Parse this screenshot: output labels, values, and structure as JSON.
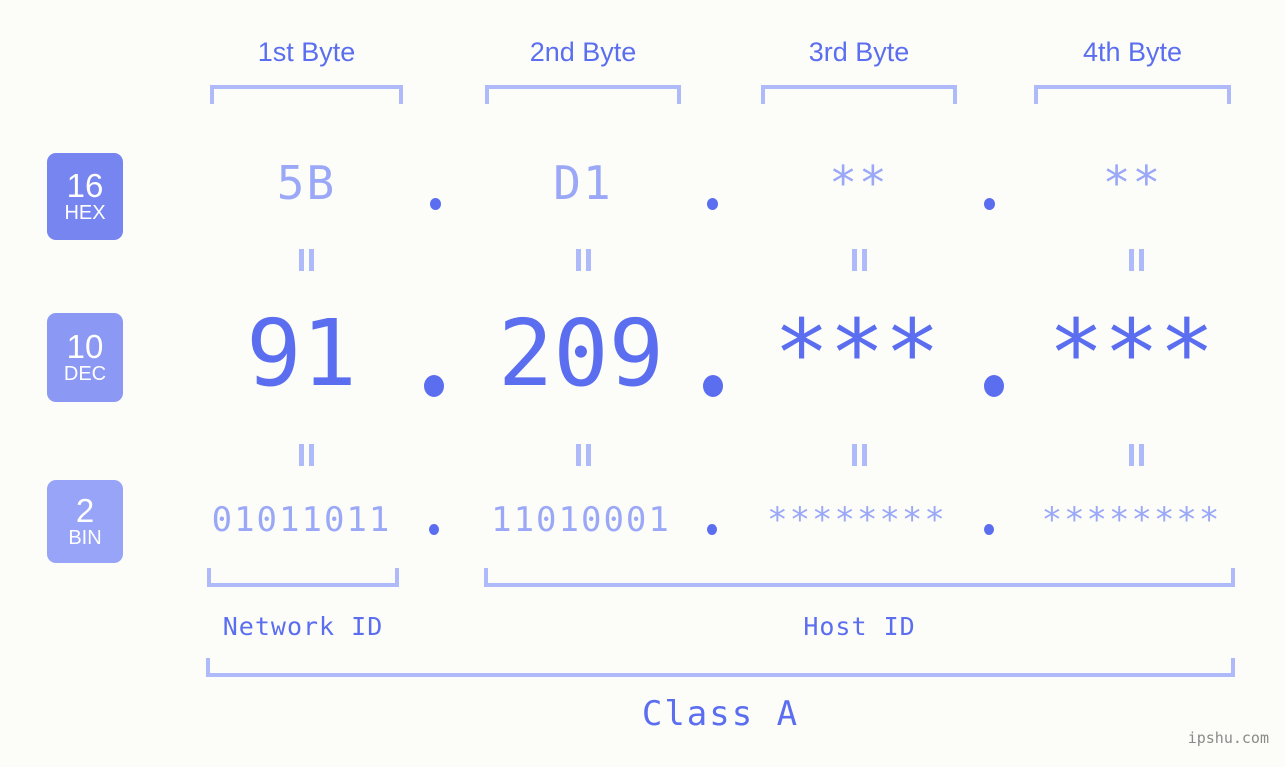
{
  "theme": {
    "background": "#fcfdf8",
    "accent_dark": "#5b6ef0",
    "accent_light": "#afbafa",
    "value_light": "#9aa8f7",
    "badge_hex": "#7685ef",
    "badge_dec": "#8b98f4",
    "badge_bin": "#97a4f7",
    "watermark_color": "#8a8a8a"
  },
  "header": {
    "bytes": [
      {
        "label": "1st Byte"
      },
      {
        "label": "2nd Byte"
      },
      {
        "label": "3rd Byte"
      },
      {
        "label": "4th Byte"
      }
    ]
  },
  "rows": [
    {
      "key": "hex",
      "badge_number": "16",
      "badge_abbr": "HEX",
      "values": [
        "5B",
        "D1",
        "**",
        "**"
      ],
      "separator": "."
    },
    {
      "key": "dec",
      "badge_number": "10",
      "badge_abbr": "DEC",
      "values": [
        "91",
        "209",
        "***",
        "***"
      ],
      "separator": "."
    },
    {
      "key": "bin",
      "badge_number": "2",
      "badge_abbr": "BIN",
      "values": [
        "01011011",
        "11010001",
        "********",
        "********"
      ],
      "separator": "."
    }
  ],
  "equality_symbol": "=",
  "segments": {
    "network_id": "Network ID",
    "host_id": "Host ID"
  },
  "class": {
    "label": "Class A"
  },
  "watermark": {
    "text": "ipshu.com"
  },
  "chart_data": {
    "type": "table",
    "title": "IPv4 address byte breakdown",
    "columns": [
      "1st Byte",
      "2nd Byte",
      "3rd Byte",
      "4th Byte"
    ],
    "rows": [
      {
        "radix": 16,
        "radix_label": "HEX",
        "values": [
          "5B",
          "D1",
          "**",
          "**"
        ]
      },
      {
        "radix": 10,
        "radix_label": "DEC",
        "values": [
          "91",
          "209",
          "***",
          "***"
        ]
      },
      {
        "radix": 2,
        "radix_label": "BIN",
        "values": [
          "01011011",
          "11010001",
          "********",
          "********"
        ]
      }
    ],
    "network_id_bytes": [
      1
    ],
    "host_id_bytes": [
      2,
      3,
      4
    ],
    "address_class": "Class A"
  }
}
